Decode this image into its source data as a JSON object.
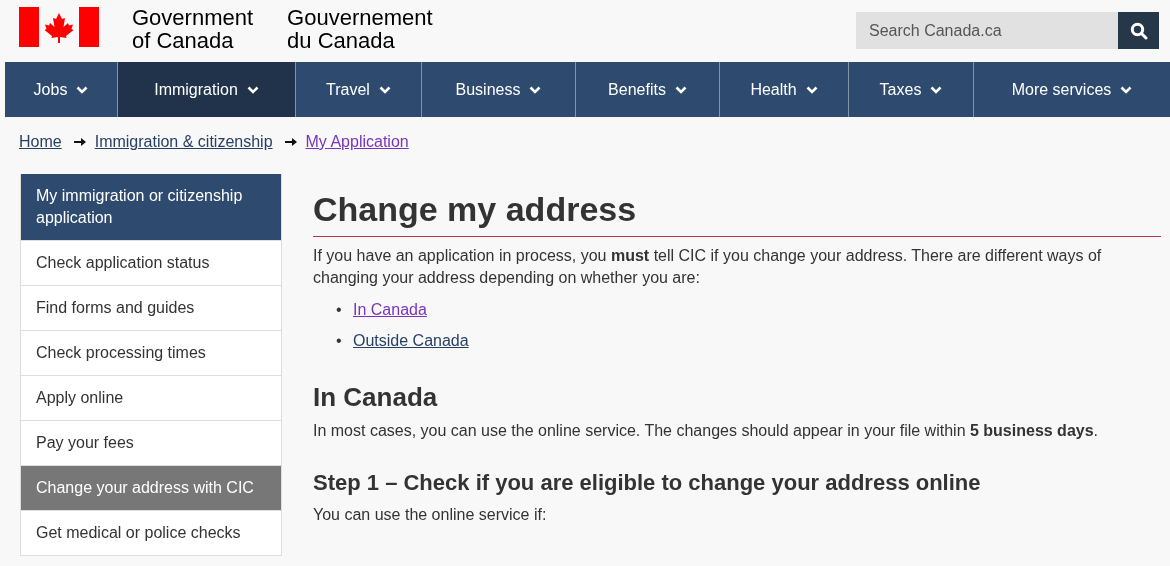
{
  "header": {
    "wordmark_en": [
      "Government",
      "of Canada"
    ],
    "wordmark_fr": [
      "Gouvernement",
      "du Canada"
    ],
    "search": {
      "placeholder": "Search Canada.ca"
    }
  },
  "nav": [
    {
      "label": "Jobs",
      "selected": false
    },
    {
      "label": "Immigration",
      "selected": true
    },
    {
      "label": "Travel",
      "selected": false
    },
    {
      "label": "Business",
      "selected": false
    },
    {
      "label": "Benefits",
      "selected": false
    },
    {
      "label": "Health",
      "selected": false
    },
    {
      "label": "Taxes",
      "selected": false
    },
    {
      "label": "More services",
      "selected": false
    }
  ],
  "breadcrumb": [
    {
      "label": "Home",
      "visited": false
    },
    {
      "label": "Immigration & citizenship",
      "visited": false
    },
    {
      "label": "My Application",
      "visited": true
    }
  ],
  "sidebar": {
    "items": [
      {
        "label": "My immigration or citizenship application",
        "kind": "header",
        "selected": false
      },
      {
        "label": "Check application status",
        "kind": "link",
        "selected": false
      },
      {
        "label": "Find forms and guides",
        "kind": "link",
        "selected": false
      },
      {
        "label": "Check processing times",
        "kind": "link",
        "selected": false
      },
      {
        "label": "Apply online",
        "kind": "link",
        "selected": false
      },
      {
        "label": "Pay your fees",
        "kind": "link",
        "selected": false
      },
      {
        "label": "Change your address with CIC",
        "kind": "link",
        "selected": true
      },
      {
        "label": "Get medical or police checks",
        "kind": "link",
        "selected": false
      }
    ]
  },
  "main": {
    "title": "Change my address",
    "intro": "If you have an application in process, you **must** tell CIC if you change your address. There are different ways of changing your address depending on whether you are:",
    "links": [
      {
        "marker": "•",
        "label": "In Canada",
        "visited": true
      },
      {
        "marker": "•",
        "label": "Outside Canada",
        "visited": false
      }
    ],
    "section_title": "In Canada",
    "section_text": "In most cases, you can use the online service. The changes should appear in your file within **5 business days**.",
    "step_title": "Step 1 – Check if you are eligible to change your address online",
    "step_text": "You can use the online service if:"
  }
}
